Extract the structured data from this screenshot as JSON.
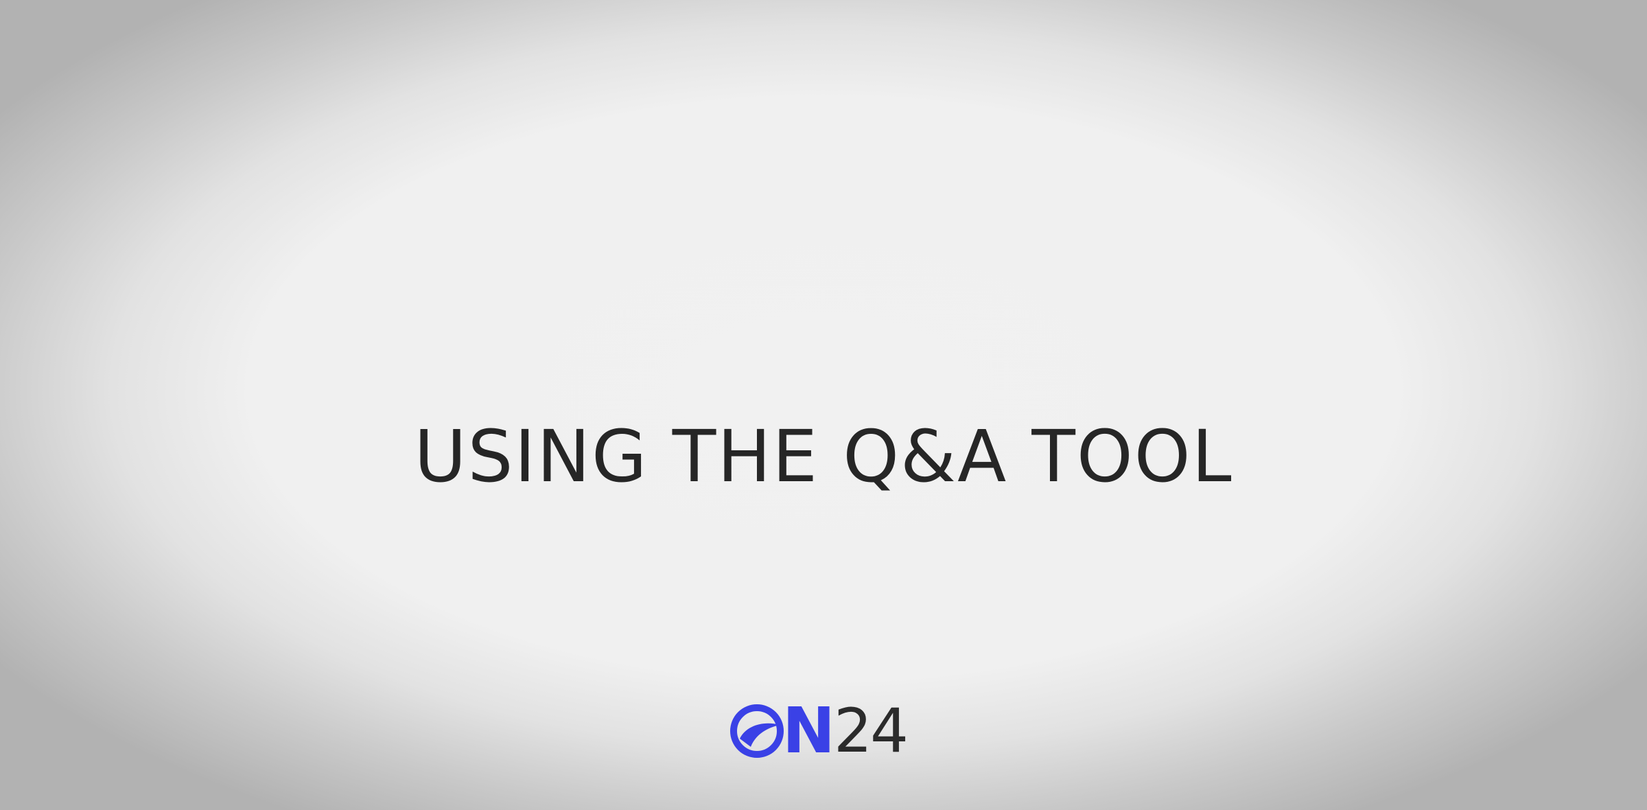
{
  "slide": {
    "title": "USING THE Q&A TOOL"
  },
  "brand": {
    "logo_text_primary": "N",
    "logo_text_secondary": "24",
    "colors": {
      "brand_blue": "#3a41e6",
      "text_dark": "#262626",
      "background": "#f0f0f0"
    },
    "icons": {
      "logo_o": "on24-o-swoosh-icon"
    }
  }
}
